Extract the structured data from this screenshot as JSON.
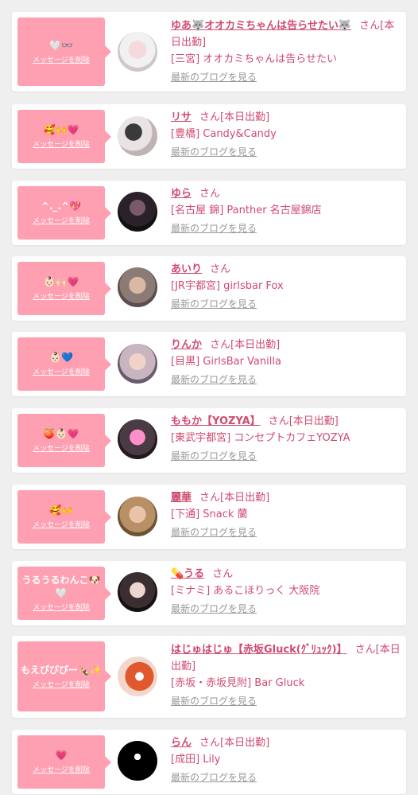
{
  "delete_label": "メッセージを削除",
  "san_label": "さん",
  "blog_label": "最新のブログを見る",
  "colors": {
    "bubble": "#ff9fb2",
    "name": "#d14a70",
    "background": "#efefef"
  },
  "items": [
    {
      "message": "🤍👓",
      "name": "ゆあ🐺オオカミちゃんは告らせたい🐺",
      "status": "[本日出勤]",
      "shop": "[三宮] オオカミちゃんは告らせたい"
    },
    {
      "message": "🥰🙌💗",
      "name": "リサ",
      "status": "[本日出勤]",
      "shop": "[豊橋] Candy&Candy"
    },
    {
      "message": "^._.^💖",
      "name": "ゆら",
      "status": "",
      "shop": "[名古屋 錦] Panther 名古屋錦店"
    },
    {
      "message": "👶🏻🙌🏻💗",
      "name": "あいり",
      "status": "",
      "shop": "[JR宇都宮] girlsbar Fox"
    },
    {
      "message": "👶🏻💙",
      "name": "りんか",
      "status": "[本日出勤]",
      "shop": "[目黒] GirlsBar Vanilla"
    },
    {
      "message": "🍑👶🏻💗",
      "name": "ももか【YOZYA】",
      "status": "[本日出勤]",
      "shop": "[東武宇都宮] コンセプトカフェYOZYA"
    },
    {
      "message": "🥰🙌",
      "name": "麗華",
      "status": "[本日出勤]",
      "shop": "[下通] Snack 蘭"
    },
    {
      "message": "うるうるわんこ🐶🤍",
      "name": "💊うる",
      "status": "",
      "shop": "[ミナミ] あるこほりっく 大阪院"
    },
    {
      "message": "もえぴぴぴー🍾✨",
      "name": "はじゅはじゅ【赤坂Gluck(ｸﾞﾘｭｯｸ)】",
      "status": "[本日出勤]",
      "shop": "[赤坂・赤坂見附] Bar Gluck"
    },
    {
      "message": "💗",
      "name": "らん",
      "status": "[本日出勤]",
      "shop": "[成田] Lily"
    }
  ]
}
